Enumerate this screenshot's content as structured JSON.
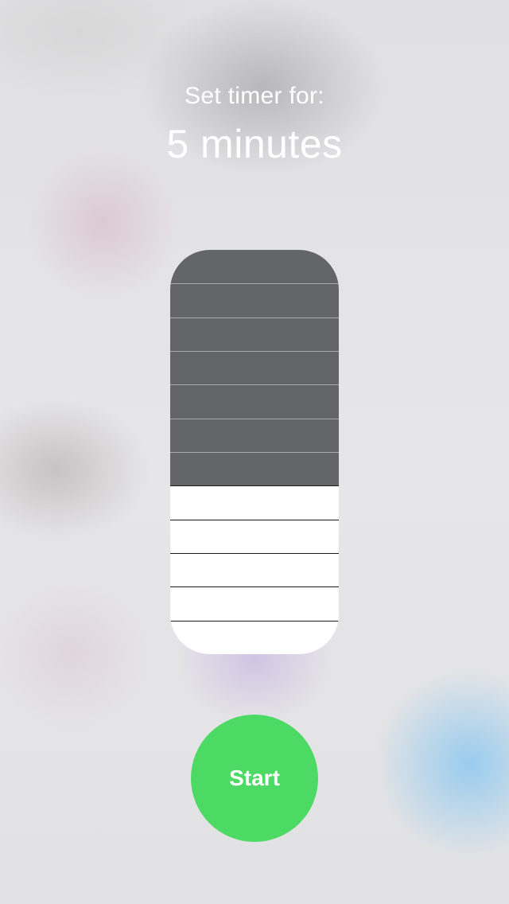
{
  "timer": {
    "prompt": "Set timer for:",
    "value_text": "5 minutes",
    "slider": {
      "segments": 12,
      "selected_segments": 7,
      "selected_fraction": 0.583,
      "fill_color": "#646567",
      "track_color": "#ffffff"
    },
    "start_label": "Start",
    "start_color": "#4cd964"
  }
}
